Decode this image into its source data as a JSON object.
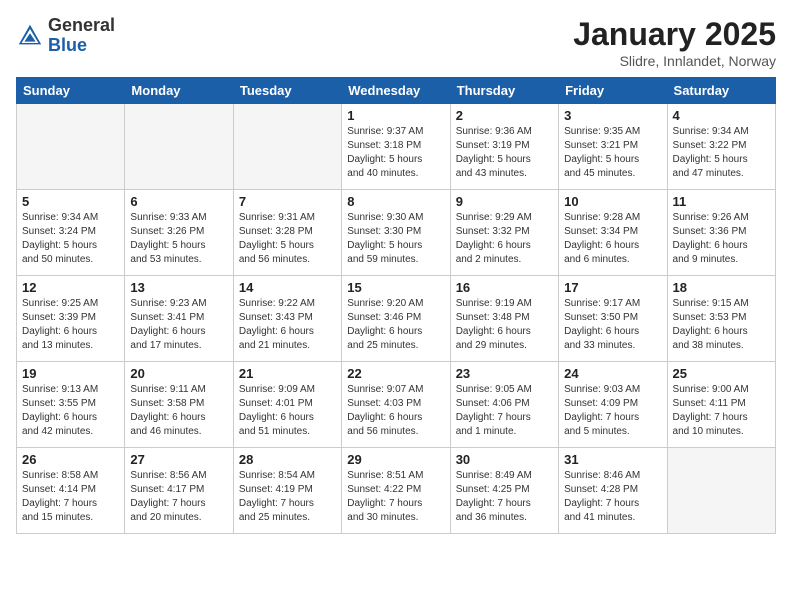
{
  "header": {
    "logo_general": "General",
    "logo_blue": "Blue",
    "month_title": "January 2025",
    "subtitle": "Slidre, Innlandet, Norway"
  },
  "weekdays": [
    "Sunday",
    "Monday",
    "Tuesday",
    "Wednesday",
    "Thursday",
    "Friday",
    "Saturday"
  ],
  "weeks": [
    [
      {
        "day": "",
        "info": ""
      },
      {
        "day": "",
        "info": ""
      },
      {
        "day": "",
        "info": ""
      },
      {
        "day": "1",
        "info": "Sunrise: 9:37 AM\nSunset: 3:18 PM\nDaylight: 5 hours\nand 40 minutes."
      },
      {
        "day": "2",
        "info": "Sunrise: 9:36 AM\nSunset: 3:19 PM\nDaylight: 5 hours\nand 43 minutes."
      },
      {
        "day": "3",
        "info": "Sunrise: 9:35 AM\nSunset: 3:21 PM\nDaylight: 5 hours\nand 45 minutes."
      },
      {
        "day": "4",
        "info": "Sunrise: 9:34 AM\nSunset: 3:22 PM\nDaylight: 5 hours\nand 47 minutes."
      }
    ],
    [
      {
        "day": "5",
        "info": "Sunrise: 9:34 AM\nSunset: 3:24 PM\nDaylight: 5 hours\nand 50 minutes."
      },
      {
        "day": "6",
        "info": "Sunrise: 9:33 AM\nSunset: 3:26 PM\nDaylight: 5 hours\nand 53 minutes."
      },
      {
        "day": "7",
        "info": "Sunrise: 9:31 AM\nSunset: 3:28 PM\nDaylight: 5 hours\nand 56 minutes."
      },
      {
        "day": "8",
        "info": "Sunrise: 9:30 AM\nSunset: 3:30 PM\nDaylight: 5 hours\nand 59 minutes."
      },
      {
        "day": "9",
        "info": "Sunrise: 9:29 AM\nSunset: 3:32 PM\nDaylight: 6 hours\nand 2 minutes."
      },
      {
        "day": "10",
        "info": "Sunrise: 9:28 AM\nSunset: 3:34 PM\nDaylight: 6 hours\nand 6 minutes."
      },
      {
        "day": "11",
        "info": "Sunrise: 9:26 AM\nSunset: 3:36 PM\nDaylight: 6 hours\nand 9 minutes."
      }
    ],
    [
      {
        "day": "12",
        "info": "Sunrise: 9:25 AM\nSunset: 3:39 PM\nDaylight: 6 hours\nand 13 minutes."
      },
      {
        "day": "13",
        "info": "Sunrise: 9:23 AM\nSunset: 3:41 PM\nDaylight: 6 hours\nand 17 minutes."
      },
      {
        "day": "14",
        "info": "Sunrise: 9:22 AM\nSunset: 3:43 PM\nDaylight: 6 hours\nand 21 minutes."
      },
      {
        "day": "15",
        "info": "Sunrise: 9:20 AM\nSunset: 3:46 PM\nDaylight: 6 hours\nand 25 minutes."
      },
      {
        "day": "16",
        "info": "Sunrise: 9:19 AM\nSunset: 3:48 PM\nDaylight: 6 hours\nand 29 minutes."
      },
      {
        "day": "17",
        "info": "Sunrise: 9:17 AM\nSunset: 3:50 PM\nDaylight: 6 hours\nand 33 minutes."
      },
      {
        "day": "18",
        "info": "Sunrise: 9:15 AM\nSunset: 3:53 PM\nDaylight: 6 hours\nand 38 minutes."
      }
    ],
    [
      {
        "day": "19",
        "info": "Sunrise: 9:13 AM\nSunset: 3:55 PM\nDaylight: 6 hours\nand 42 minutes."
      },
      {
        "day": "20",
        "info": "Sunrise: 9:11 AM\nSunset: 3:58 PM\nDaylight: 6 hours\nand 46 minutes."
      },
      {
        "day": "21",
        "info": "Sunrise: 9:09 AM\nSunset: 4:01 PM\nDaylight: 6 hours\nand 51 minutes."
      },
      {
        "day": "22",
        "info": "Sunrise: 9:07 AM\nSunset: 4:03 PM\nDaylight: 6 hours\nand 56 minutes."
      },
      {
        "day": "23",
        "info": "Sunrise: 9:05 AM\nSunset: 4:06 PM\nDaylight: 7 hours\nand 1 minute."
      },
      {
        "day": "24",
        "info": "Sunrise: 9:03 AM\nSunset: 4:09 PM\nDaylight: 7 hours\nand 5 minutes."
      },
      {
        "day": "25",
        "info": "Sunrise: 9:00 AM\nSunset: 4:11 PM\nDaylight: 7 hours\nand 10 minutes."
      }
    ],
    [
      {
        "day": "26",
        "info": "Sunrise: 8:58 AM\nSunset: 4:14 PM\nDaylight: 7 hours\nand 15 minutes."
      },
      {
        "day": "27",
        "info": "Sunrise: 8:56 AM\nSunset: 4:17 PM\nDaylight: 7 hours\nand 20 minutes."
      },
      {
        "day": "28",
        "info": "Sunrise: 8:54 AM\nSunset: 4:19 PM\nDaylight: 7 hours\nand 25 minutes."
      },
      {
        "day": "29",
        "info": "Sunrise: 8:51 AM\nSunset: 4:22 PM\nDaylight: 7 hours\nand 30 minutes."
      },
      {
        "day": "30",
        "info": "Sunrise: 8:49 AM\nSunset: 4:25 PM\nDaylight: 7 hours\nand 36 minutes."
      },
      {
        "day": "31",
        "info": "Sunrise: 8:46 AM\nSunset: 4:28 PM\nDaylight: 7 hours\nand 41 minutes."
      },
      {
        "day": "",
        "info": ""
      }
    ]
  ]
}
